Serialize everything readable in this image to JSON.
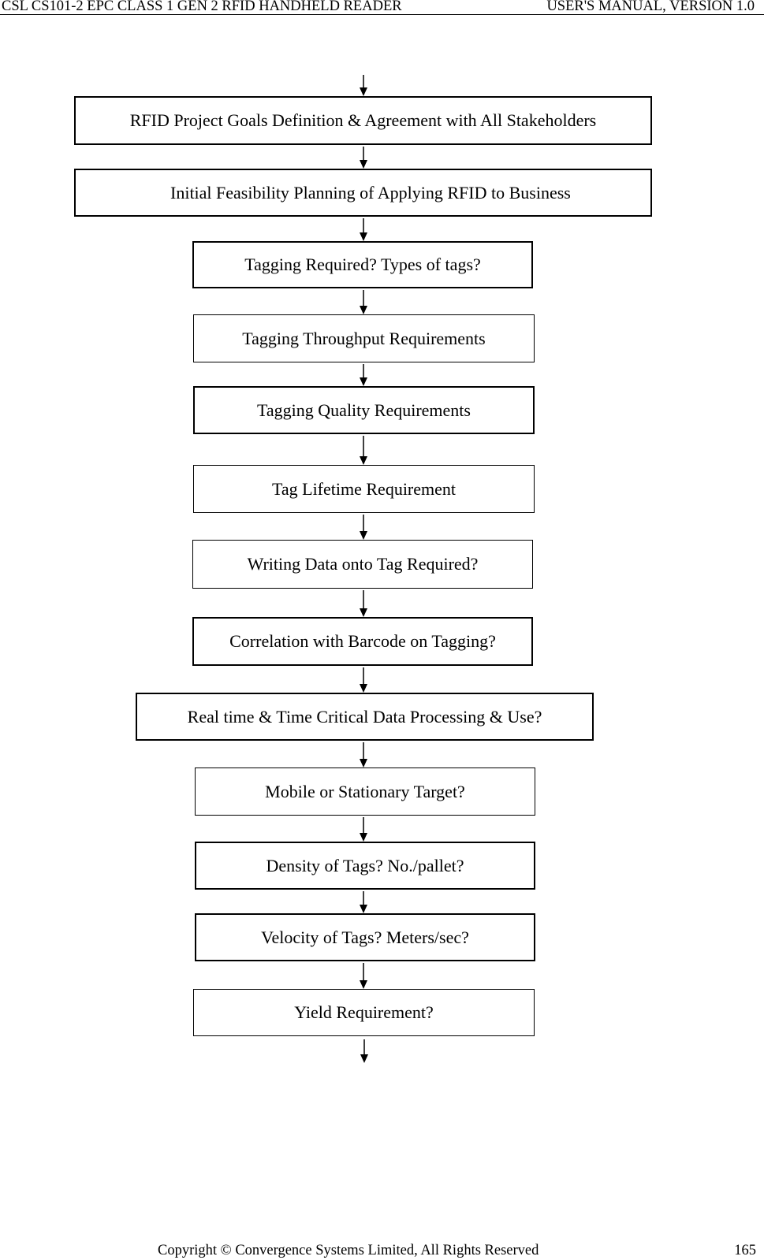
{
  "header": {
    "left": "CSL CS101-2 EPC CLASS 1 GEN 2 RFID HANDHELD READER",
    "right": "USER'S  MANUAL,  VERSION  1.0"
  },
  "flowchart": {
    "steps": [
      {
        "label": "RFID Project Goals Definition & Agreement with All Stakeholders"
      },
      {
        "label": "Initial Feasibility Planning of Applying RFID to Business"
      },
      {
        "label": "Tagging Required? Types of tags?"
      },
      {
        "label": "Tagging Throughput Requirements"
      },
      {
        "label": "Tagging Quality Requirements"
      },
      {
        "label": "Tag Lifetime Requirement"
      },
      {
        "label": "Writing Data onto Tag Required?"
      },
      {
        "label": "Correlation with Barcode on Tagging?"
      },
      {
        "label": "Real time & Time Critical Data Processing & Use?"
      },
      {
        "label": "Mobile or Stationary Target?"
      },
      {
        "label": "Density of Tags? No./pallet?"
      },
      {
        "label": "Velocity of Tags? Meters/sec?"
      },
      {
        "label": "Yield Requirement?"
      }
    ]
  },
  "footer": {
    "copyright": "Copyright © Convergence Systems Limited, All Rights Reserved",
    "page_number": "165"
  }
}
